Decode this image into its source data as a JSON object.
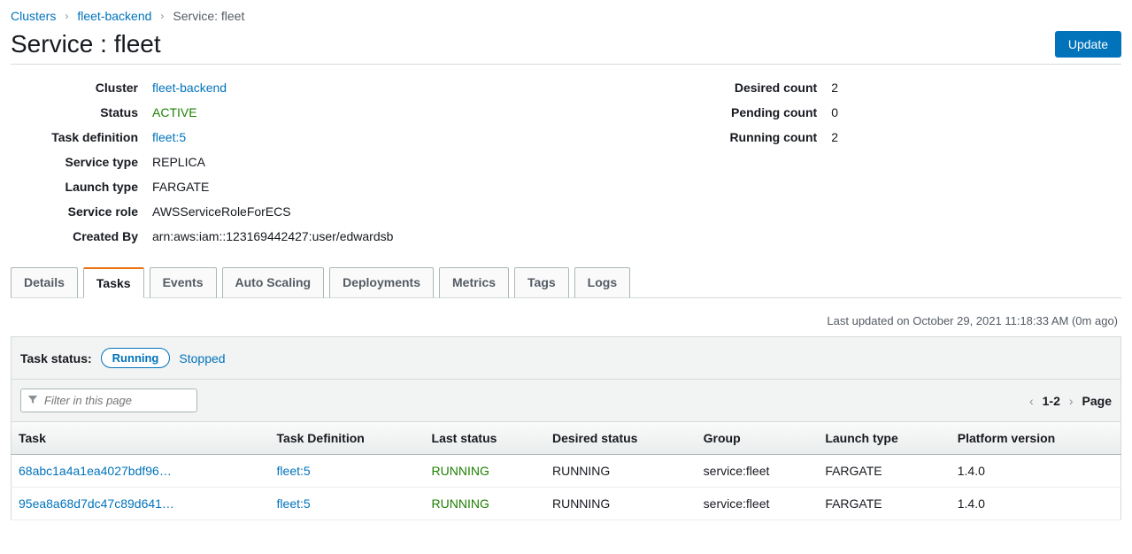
{
  "breadcrumb": {
    "clusters": "Clusters",
    "cluster_name": "fleet-backend",
    "current": "Service: fleet"
  },
  "page_title": "Service : fleet",
  "update_button": "Update",
  "details": {
    "left": [
      {
        "label": "Cluster",
        "value": "fleet-backend",
        "kind": "link"
      },
      {
        "label": "Status",
        "value": "ACTIVE",
        "kind": "green"
      },
      {
        "label": "Task definition",
        "value": "fleet:5",
        "kind": "link"
      },
      {
        "label": "Service type",
        "value": "REPLICA",
        "kind": "text"
      },
      {
        "label": "Launch type",
        "value": "FARGATE",
        "kind": "text"
      },
      {
        "label": "Service role",
        "value": "AWSServiceRoleForECS",
        "kind": "text"
      },
      {
        "label": "Created By",
        "value": "arn:aws:iam::123169442427:user/edwardsb",
        "kind": "text"
      }
    ],
    "right": [
      {
        "label": "Desired count",
        "value": "2"
      },
      {
        "label": "Pending count",
        "value": "0"
      },
      {
        "label": "Running count",
        "value": "2"
      }
    ]
  },
  "tabs": {
    "items": [
      "Details",
      "Tasks",
      "Events",
      "Auto Scaling",
      "Deployments",
      "Metrics",
      "Tags",
      "Logs"
    ],
    "active": "Tasks"
  },
  "last_updated": "Last updated on October 29, 2021 11:18:33 AM (0m ago)",
  "task_status": {
    "label": "Task status:",
    "running": "Running",
    "stopped": "Stopped"
  },
  "filter_placeholder": "Filter in this page",
  "pager": {
    "range": "1-2",
    "page_label": "Page"
  },
  "table": {
    "headers": [
      "Task",
      "Task Definition",
      "Last status",
      "Desired status",
      "Group",
      "Launch type",
      "Platform version"
    ],
    "rows": [
      {
        "task": "68abc1a4a1ea4027bdf96…",
        "task_def": "fleet:5",
        "last_status": "RUNNING",
        "desired_status": "RUNNING",
        "group": "service:fleet",
        "launch_type": "FARGATE",
        "platform_version": "1.4.0"
      },
      {
        "task": "95ea8a68d7dc47c89d641…",
        "task_def": "fleet:5",
        "last_status": "RUNNING",
        "desired_status": "RUNNING",
        "group": "service:fleet",
        "launch_type": "FARGATE",
        "platform_version": "1.4.0"
      }
    ]
  }
}
